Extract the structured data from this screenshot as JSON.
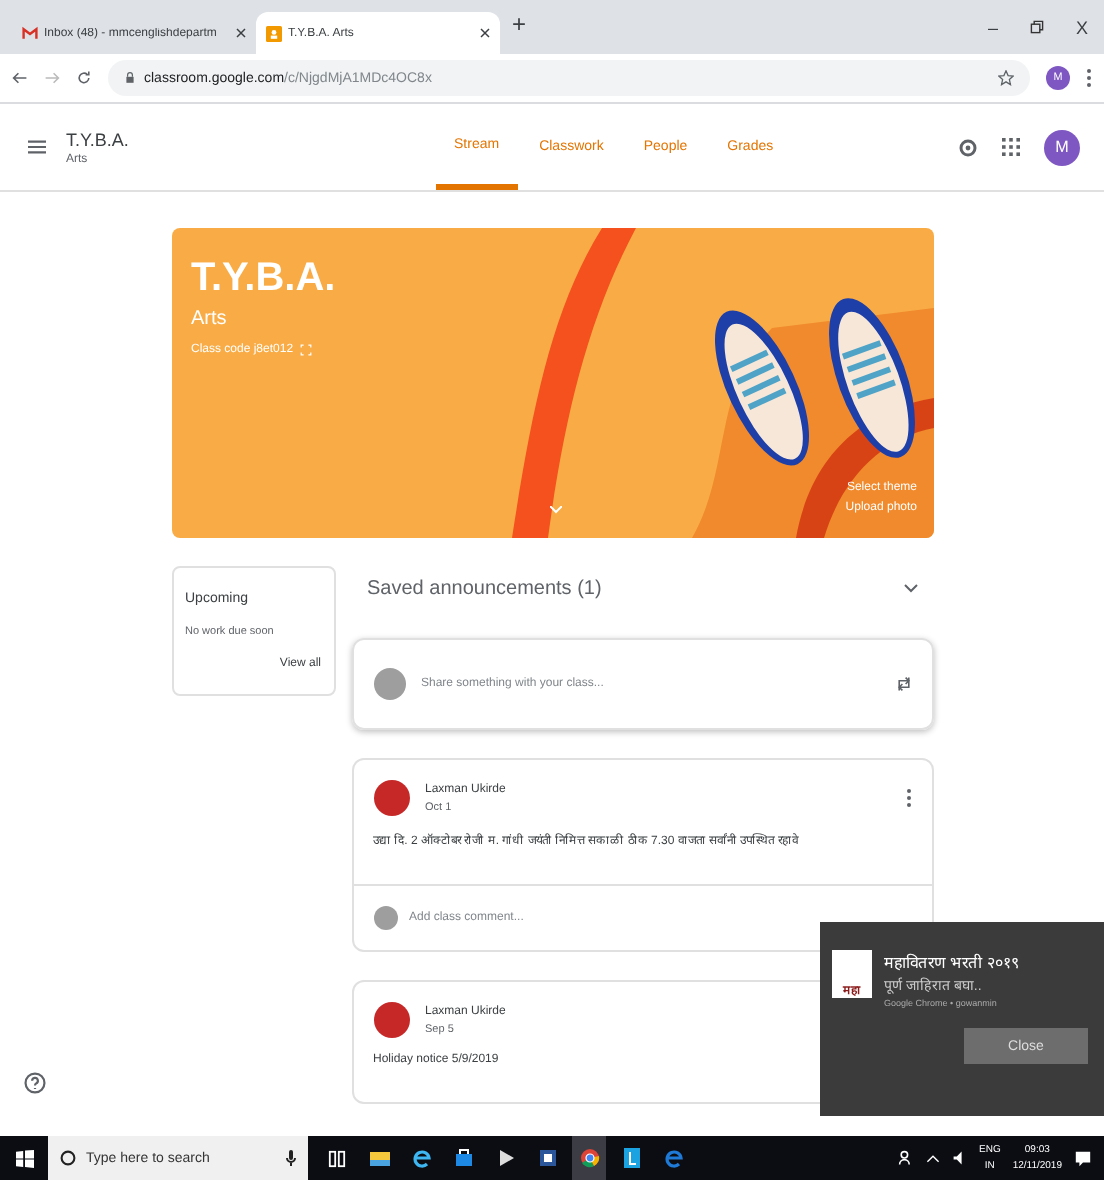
{
  "browser": {
    "tabs": [
      {
        "kind": "mail",
        "title": "Inbox (48) - mmcenglishdepartm",
        "selected": false
      },
      {
        "kind": "classroom",
        "title": "T.Y.B.A. Arts",
        "selected": true
      }
    ],
    "new_tab": "+",
    "window_controls": [
      "–",
      "X"
    ],
    "url_host": "classroom.google.com",
    "url_path": "/c/NjgdMjA1MDc4OC8x",
    "profile": "M"
  },
  "app": {
    "title": "T.Y.B.A.",
    "subtitle": "Arts",
    "avatar": "M",
    "tabs": [
      {
        "label": "Stream",
        "selected": true
      },
      {
        "label": "Classwork",
        "selected": false
      },
      {
        "label": "People",
        "selected": false
      },
      {
        "label": "Grades",
        "selected": false
      }
    ]
  },
  "banner": {
    "title": "T.Y.B.A.",
    "subtitle": "Arts",
    "class_code": "Class code  j8et012",
    "links": [
      "Select theme",
      "Upload photo"
    ]
  },
  "upcoming": {
    "title": "Upcoming",
    "empty": "No work due soon",
    "link": "View all"
  },
  "saved": {
    "label": "Saved announcements (1)",
    "expanded": false
  },
  "share_placeholder": "Share something with your class...",
  "posts": [
    {
      "author": "Laxman Ukirde",
      "date": "Oct 1",
      "body": "उद्या दि. 2 ऑक्टोबर रोजी म. गांधी जयंती निमित्त सकाळी ठीक 7.30 वाजता सर्वांनी उपस्थित रहावे",
      "comment_placeholder": "Add class comment..."
    },
    {
      "author": "Laxman Ukirde",
      "date": "Sep 5",
      "body": "Holiday notice 5/9/2019"
    }
  ],
  "notification": {
    "title": "महावितरण भरती २०१९",
    "body": "पूर्ण जाहिरात बघा..",
    "source": "Google Chrome • gowanmin",
    "logo_text": "महा",
    "button": "Close"
  },
  "taskbar": {
    "search_placeholder": "Type here to search",
    "apps": [
      {
        "kind": "task-view",
        "selected": false
      },
      {
        "kind": "folder",
        "selected": false
      },
      {
        "kind": "edge",
        "selected": false
      },
      {
        "kind": "store",
        "selected": false
      },
      {
        "kind": "media",
        "selected": false
      },
      {
        "kind": "word",
        "selected": false
      },
      {
        "kind": "chrome",
        "selected": true
      },
      {
        "kind": "tile",
        "selected": false
      },
      {
        "kind": "ie",
        "selected": false
      }
    ],
    "language": [
      "ENG",
      "IN"
    ],
    "time": "09:03",
    "date": "12/11/2019"
  }
}
